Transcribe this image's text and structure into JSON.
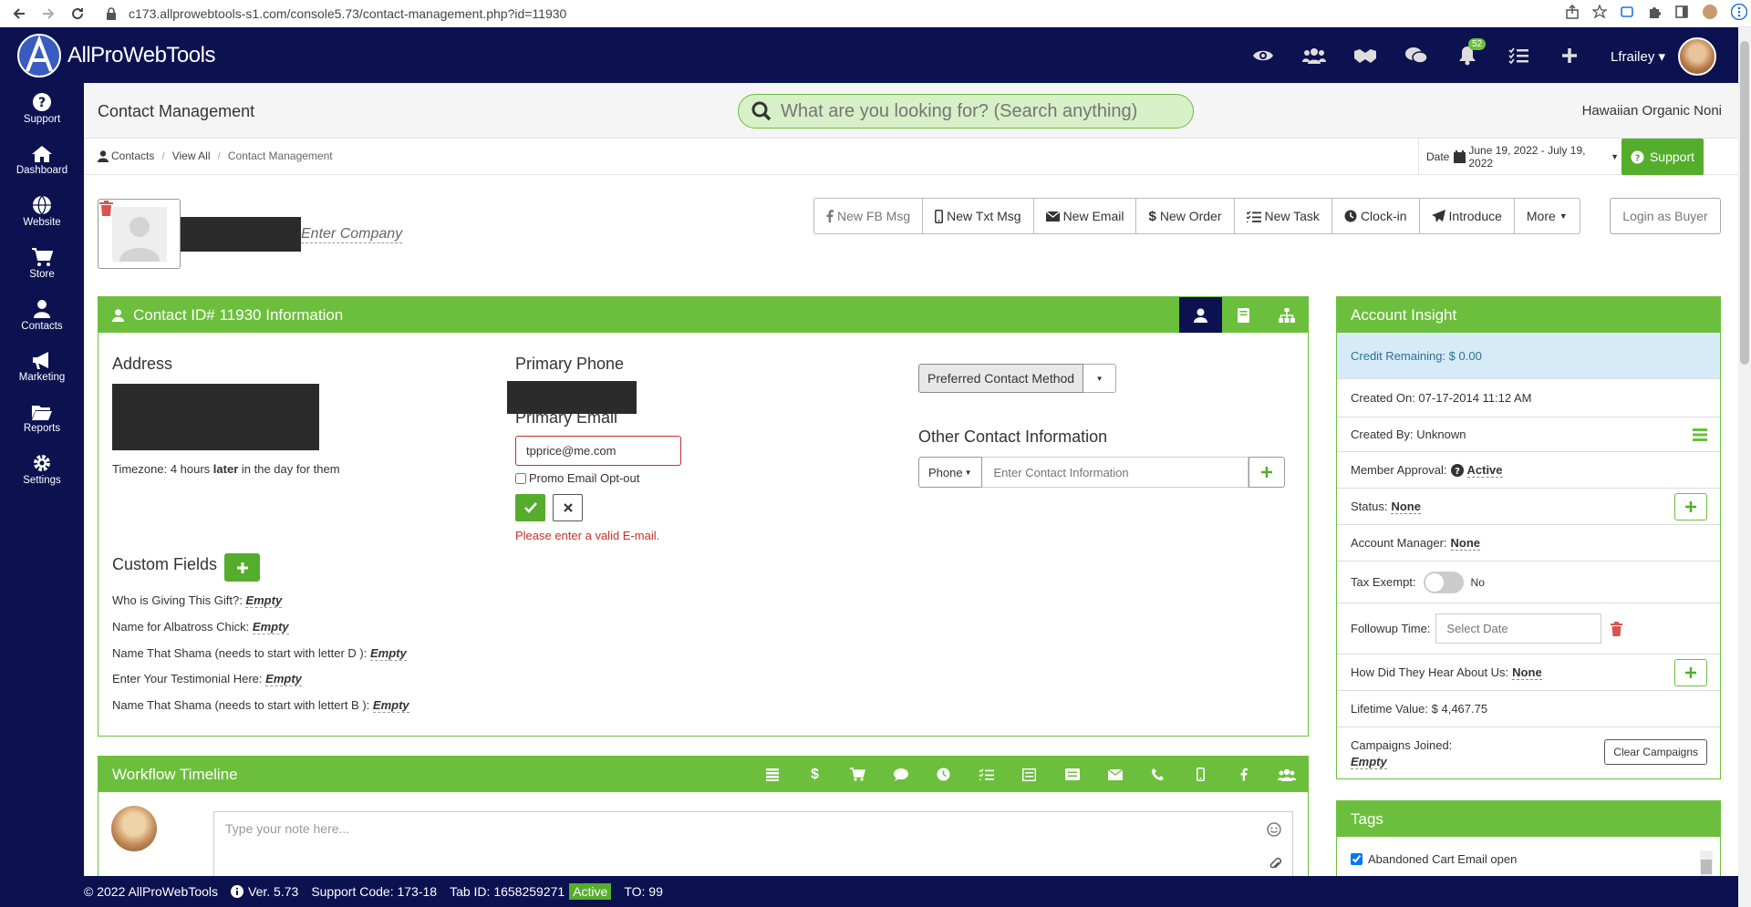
{
  "browser": {
    "url": "c173.allprowebtools-s1.com/console5.73/contact-management.php?id=11930"
  },
  "app": {
    "brand": "AllProWebTools",
    "notification_count": "52",
    "user": "Lfrailey"
  },
  "sidebar": {
    "items": [
      {
        "label": "Support",
        "icon": "question-icon"
      },
      {
        "label": "Dashboard",
        "icon": "home-icon"
      },
      {
        "label": "Website",
        "icon": "globe-icon"
      },
      {
        "label": "Store",
        "icon": "cart-icon"
      },
      {
        "label": "Contacts",
        "icon": "user-icon"
      },
      {
        "label": "Marketing",
        "icon": "megaphone-icon"
      },
      {
        "label": "Reports",
        "icon": "folder-icon"
      },
      {
        "label": "Settings",
        "icon": "gear-icon"
      }
    ]
  },
  "header": {
    "title": "Contact Management",
    "search_placeholder": "What are you looking for? (Search anything)",
    "company": "Hawaiian Organic Noni"
  },
  "breadcrumb": {
    "items": [
      "Contacts",
      "View All",
      "Contact Management"
    ]
  },
  "date": {
    "label": "Date",
    "range": "June 19, 2022 - July 19, 2022"
  },
  "support_button": "Support",
  "contact": {
    "company_placeholder": "Enter Company"
  },
  "actions": {
    "buttons": [
      "New FB Msg",
      "New Txt Msg",
      "New Email",
      "New Order",
      "New Task",
      "Clock-in",
      "Introduce",
      "More"
    ],
    "login_as_buyer": "Login as Buyer"
  },
  "info_panel": {
    "title": "Contact ID# 11930 Information",
    "address_label": "Address",
    "timezone_prefix": "Timezone: 4 hours ",
    "timezone_bold": "later",
    "timezone_suffix": " in the day for them",
    "primary_phone_label": "Primary Phone",
    "primary_email_label": "Primary Email",
    "email_value": "tpprice@me.com",
    "promo_optout": "Promo Email Opt-out",
    "email_error": "Please enter a valid E-mail.",
    "preferred_contact": "Preferred Contact Method",
    "other_contact_label": "Other Contact Information",
    "phone_select": "Phone",
    "contact_placeholder": "Enter Contact Information",
    "custom_fields_label": "Custom Fields",
    "custom_fields": [
      {
        "label": "Who is Giving This Gift?:",
        "value": "Empty"
      },
      {
        "label": "Name for Albatross Chick:",
        "value": "Empty"
      },
      {
        "label": "Name That Shama (needs to start with letter D ):",
        "value": "Empty"
      },
      {
        "label": "Enter Your Testimonial Here:",
        "value": "Empty"
      },
      {
        "label": "Name That Shama (needs to start with lettert B ):",
        "value": "Empty"
      }
    ]
  },
  "insight": {
    "title": "Account Insight",
    "credit": "Credit Remaining: $ 0.00",
    "created_on": "Created On: 07-17-2014 11:12 AM",
    "created_by": "Created By: Unknown",
    "member_approval_label": "Member Approval:",
    "member_approval_value": "Active",
    "status_label": "Status:",
    "status_value": "None",
    "account_manager_label": "Account Manager:",
    "account_manager_value": "None",
    "tax_exempt_label": "Tax Exempt:",
    "tax_exempt_value": "No",
    "followup_label": "Followup Time:",
    "followup_placeholder": "Select Date",
    "hear_label": "How Did They Hear About Us:",
    "hear_value": "None",
    "lifetime": "Lifetime Value: $ 4,467.75",
    "campaigns_label": "Campaigns Joined:",
    "campaigns_value": "Empty",
    "clear_campaigns": "Clear Campaigns"
  },
  "workflow": {
    "title": "Workflow Timeline",
    "note_placeholder": "Type your note here..."
  },
  "tags": {
    "title": "Tags",
    "items": [
      "Abandoned Cart Email open"
    ]
  },
  "footer": {
    "copyright": "© 2022 AllProWebTools",
    "version": "Ver. 5.73",
    "support_code": "Support Code: 173-18",
    "tab_id": "Tab ID: 1658259271",
    "status": "Active",
    "to": "TO: 99"
  }
}
